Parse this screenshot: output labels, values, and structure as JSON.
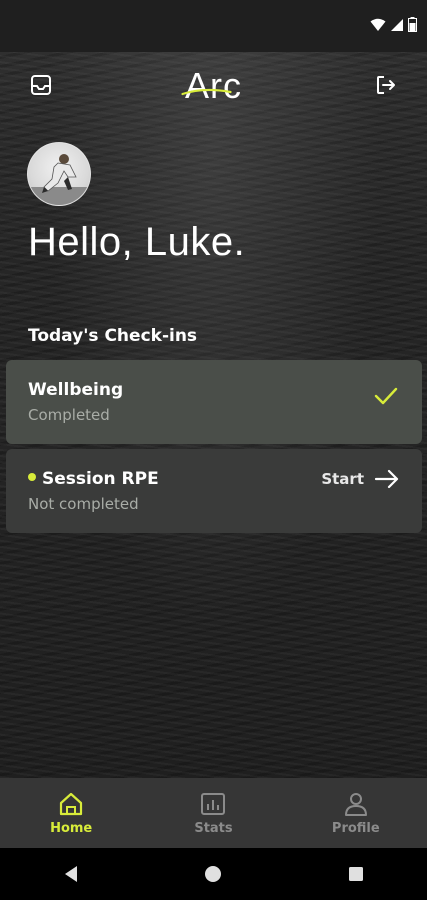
{
  "app": {
    "brand": "Arc"
  },
  "user": {
    "greeting": "Hello, Luke."
  },
  "checkins": {
    "section_title": "Today's Check-ins",
    "items": [
      {
        "title": "Wellbeing",
        "status": "Completed",
        "completed": true
      },
      {
        "title": "Session RPE",
        "status": "Not completed",
        "completed": false,
        "action_label": "Start"
      }
    ]
  },
  "nav": {
    "items": [
      {
        "label": "Home",
        "icon": "home-icon",
        "active": true
      },
      {
        "label": "Stats",
        "icon": "stats-icon",
        "active": false
      },
      {
        "label": "Profile",
        "icon": "profile-icon",
        "active": false
      }
    ]
  },
  "colors": {
    "accent": "#d8ec3a",
    "completed_card": "#4a4e49",
    "pending_card": "#3a3b3a",
    "nav_bg": "#363636"
  },
  "icons": {
    "inbox": "inbox-icon",
    "logout": "logout-icon",
    "check": "check-icon",
    "arrow": "arrow-right-icon"
  }
}
